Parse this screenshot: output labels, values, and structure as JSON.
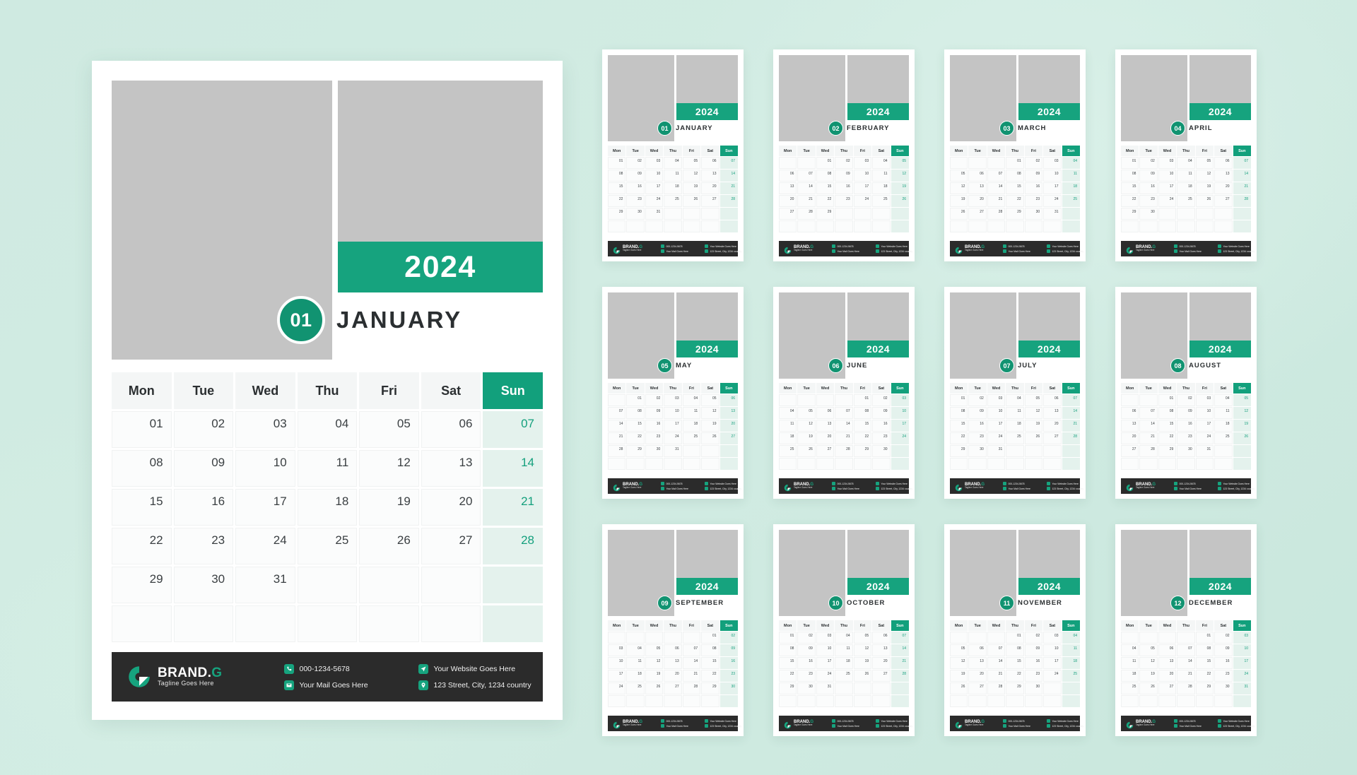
{
  "theme": {
    "accent": "#16a37e",
    "accent_dark": "#119371",
    "sunday_tint": "#e4f2ed",
    "footer_bg": "#2b2b2b",
    "placeholder_gray": "#c4c4c4",
    "background": "#cfeae1"
  },
  "year": "2024",
  "weekdays": [
    "Mon",
    "Tue",
    "Wed",
    "Thu",
    "Fri",
    "Sat",
    "Sun"
  ],
  "featured": {
    "month_number": "01",
    "month_name": "JANUARY",
    "year": "2024",
    "weeks": [
      [
        "01",
        "02",
        "03",
        "04",
        "05",
        "06",
        "07"
      ],
      [
        "08",
        "09",
        "10",
        "11",
        "12",
        "13",
        "14"
      ],
      [
        "15",
        "16",
        "17",
        "18",
        "19",
        "20",
        "21"
      ],
      [
        "22",
        "23",
        "24",
        "25",
        "26",
        "27",
        "28"
      ],
      [
        "29",
        "30",
        "31",
        "",
        "",
        "",
        ""
      ],
      [
        "",
        "",
        "",
        "",
        "",
        "",
        ""
      ]
    ]
  },
  "brand": {
    "name_main": "BRAND.",
    "name_accent": "G",
    "tagline": "Tagline Goes Here",
    "contacts": [
      {
        "icon": "phone-icon",
        "text": "000-1234-5678"
      },
      {
        "icon": "mail-icon",
        "text": "Your Mail Goes Here"
      },
      {
        "icon": "website-icon",
        "text": "Your Website Goes Here"
      },
      {
        "icon": "location-icon",
        "text": "123 Street, City, 1234 country"
      }
    ]
  },
  "months": [
    {
      "number": "01",
      "name": "JANUARY",
      "weeks": [
        [
          "01",
          "02",
          "03",
          "04",
          "05",
          "06",
          "07"
        ],
        [
          "08",
          "09",
          "10",
          "11",
          "12",
          "13",
          "14"
        ],
        [
          "15",
          "16",
          "17",
          "18",
          "19",
          "20",
          "21"
        ],
        [
          "22",
          "23",
          "24",
          "25",
          "26",
          "27",
          "28"
        ],
        [
          "29",
          "30",
          "31",
          "",
          "",
          "",
          ""
        ],
        [
          "",
          "",
          "",
          "",
          "",
          "",
          ""
        ]
      ]
    },
    {
      "number": "02",
      "name": "FEBRUARY",
      "weeks": [
        [
          "",
          "",
          "01",
          "02",
          "03",
          "04",
          "05"
        ],
        [
          "06",
          "07",
          "08",
          "09",
          "10",
          "11",
          "12"
        ],
        [
          "13",
          "14",
          "15",
          "16",
          "17",
          "18",
          "19"
        ],
        [
          "20",
          "21",
          "22",
          "23",
          "24",
          "25",
          "26"
        ],
        [
          "27",
          "28",
          "29",
          "",
          "",
          "",
          ""
        ],
        [
          "",
          "",
          "",
          "",
          "",
          "",
          ""
        ]
      ]
    },
    {
      "number": "03",
      "name": "MARCH",
      "weeks": [
        [
          "",
          "",
          "",
          "01",
          "02",
          "03",
          "04"
        ],
        [
          "05",
          "06",
          "07",
          "08",
          "09",
          "10",
          "11"
        ],
        [
          "12",
          "13",
          "14",
          "15",
          "16",
          "17",
          "18"
        ],
        [
          "19",
          "20",
          "21",
          "22",
          "23",
          "24",
          "25"
        ],
        [
          "26",
          "27",
          "28",
          "29",
          "30",
          "31",
          ""
        ],
        [
          "",
          "",
          "",
          "",
          "",
          "",
          ""
        ]
      ]
    },
    {
      "number": "04",
      "name": "APRIL",
      "weeks": [
        [
          "01",
          "02",
          "03",
          "04",
          "05",
          "06",
          "07"
        ],
        [
          "08",
          "09",
          "10",
          "11",
          "12",
          "13",
          "14"
        ],
        [
          "15",
          "16",
          "17",
          "18",
          "19",
          "20",
          "21"
        ],
        [
          "22",
          "23",
          "24",
          "25",
          "26",
          "27",
          "28"
        ],
        [
          "29",
          "30",
          "",
          "",
          "",
          "",
          ""
        ],
        [
          "",
          "",
          "",
          "",
          "",
          "",
          ""
        ]
      ]
    },
    {
      "number": "05",
      "name": "MAY",
      "weeks": [
        [
          "",
          "01",
          "02",
          "03",
          "04",
          "05",
          "06"
        ],
        [
          "07",
          "08",
          "09",
          "10",
          "11",
          "12",
          "13"
        ],
        [
          "14",
          "15",
          "16",
          "17",
          "18",
          "19",
          "20"
        ],
        [
          "21",
          "22",
          "23",
          "24",
          "25",
          "26",
          "27"
        ],
        [
          "28",
          "29",
          "30",
          "31",
          "",
          "",
          ""
        ],
        [
          "",
          "",
          "",
          "",
          "",
          "",
          ""
        ]
      ]
    },
    {
      "number": "06",
      "name": "JUNE",
      "weeks": [
        [
          "",
          "",
          "",
          "",
          "01",
          "02",
          "03"
        ],
        [
          "04",
          "05",
          "06",
          "07",
          "08",
          "09",
          "10"
        ],
        [
          "11",
          "12",
          "13",
          "14",
          "15",
          "16",
          "17"
        ],
        [
          "18",
          "19",
          "20",
          "21",
          "22",
          "23",
          "24"
        ],
        [
          "25",
          "26",
          "27",
          "28",
          "29",
          "30",
          ""
        ],
        [
          "",
          "",
          "",
          "",
          "",
          "",
          ""
        ]
      ]
    },
    {
      "number": "07",
      "name": "JULY",
      "weeks": [
        [
          "01",
          "02",
          "03",
          "04",
          "05",
          "06",
          "07"
        ],
        [
          "08",
          "09",
          "10",
          "11",
          "12",
          "13",
          "14"
        ],
        [
          "15",
          "16",
          "17",
          "18",
          "19",
          "20",
          "21"
        ],
        [
          "22",
          "23",
          "24",
          "25",
          "26",
          "27",
          "28"
        ],
        [
          "29",
          "30",
          "31",
          "",
          "",
          "",
          ""
        ],
        [
          "",
          "",
          "",
          "",
          "",
          "",
          ""
        ]
      ]
    },
    {
      "number": "08",
      "name": "AUGUST",
      "weeks": [
        [
          "",
          "",
          "01",
          "02",
          "03",
          "04",
          "05"
        ],
        [
          "06",
          "07",
          "08",
          "09",
          "10",
          "11",
          "12"
        ],
        [
          "13",
          "14",
          "15",
          "16",
          "17",
          "18",
          "19"
        ],
        [
          "20",
          "21",
          "22",
          "23",
          "24",
          "25",
          "26"
        ],
        [
          "27",
          "28",
          "29",
          "30",
          "31",
          "",
          ""
        ],
        [
          "",
          "",
          "",
          "",
          "",
          "",
          ""
        ]
      ]
    },
    {
      "number": "09",
      "name": "SEPTEMBER",
      "weeks": [
        [
          "",
          "",
          "",
          "",
          "",
          "01",
          "02"
        ],
        [
          "03",
          "04",
          "05",
          "06",
          "07",
          "08",
          "09"
        ],
        [
          "10",
          "11",
          "12",
          "13",
          "14",
          "15",
          "16"
        ],
        [
          "17",
          "18",
          "19",
          "20",
          "21",
          "22",
          "23"
        ],
        [
          "24",
          "25",
          "26",
          "27",
          "28",
          "29",
          "30"
        ],
        [
          "",
          "",
          "",
          "",
          "",
          "",
          ""
        ]
      ]
    },
    {
      "number": "10",
      "name": "OCTOBER",
      "weeks": [
        [
          "01",
          "02",
          "03",
          "04",
          "05",
          "06",
          "07"
        ],
        [
          "08",
          "09",
          "10",
          "11",
          "12",
          "13",
          "14"
        ],
        [
          "15",
          "16",
          "17",
          "18",
          "19",
          "20",
          "21"
        ],
        [
          "22",
          "23",
          "24",
          "25",
          "26",
          "27",
          "28"
        ],
        [
          "29",
          "30",
          "31",
          "",
          "",
          "",
          ""
        ],
        [
          "",
          "",
          "",
          "",
          "",
          "",
          ""
        ]
      ]
    },
    {
      "number": "11",
      "name": "NOVEMBER",
      "weeks": [
        [
          "",
          "",
          "",
          "01",
          "02",
          "03",
          "04"
        ],
        [
          "05",
          "06",
          "07",
          "08",
          "09",
          "10",
          "11"
        ],
        [
          "12",
          "13",
          "14",
          "15",
          "16",
          "17",
          "18"
        ],
        [
          "19",
          "20",
          "21",
          "22",
          "23",
          "24",
          "25"
        ],
        [
          "26",
          "27",
          "28",
          "29",
          "30",
          "",
          ""
        ],
        [
          "",
          "",
          "",
          "",
          "",
          "",
          ""
        ]
      ]
    },
    {
      "number": "12",
      "name": "DECEMBER",
      "weeks": [
        [
          "",
          "",
          "",
          "",
          "01",
          "02",
          "03"
        ],
        [
          "04",
          "05",
          "06",
          "07",
          "08",
          "09",
          "10"
        ],
        [
          "11",
          "12",
          "13",
          "14",
          "15",
          "16",
          "17"
        ],
        [
          "18",
          "19",
          "20",
          "21",
          "22",
          "23",
          "24"
        ],
        [
          "25",
          "26",
          "27",
          "28",
          "29",
          "30",
          "31"
        ],
        [
          "",
          "",
          "",
          "",
          "",
          "",
          ""
        ]
      ]
    }
  ]
}
